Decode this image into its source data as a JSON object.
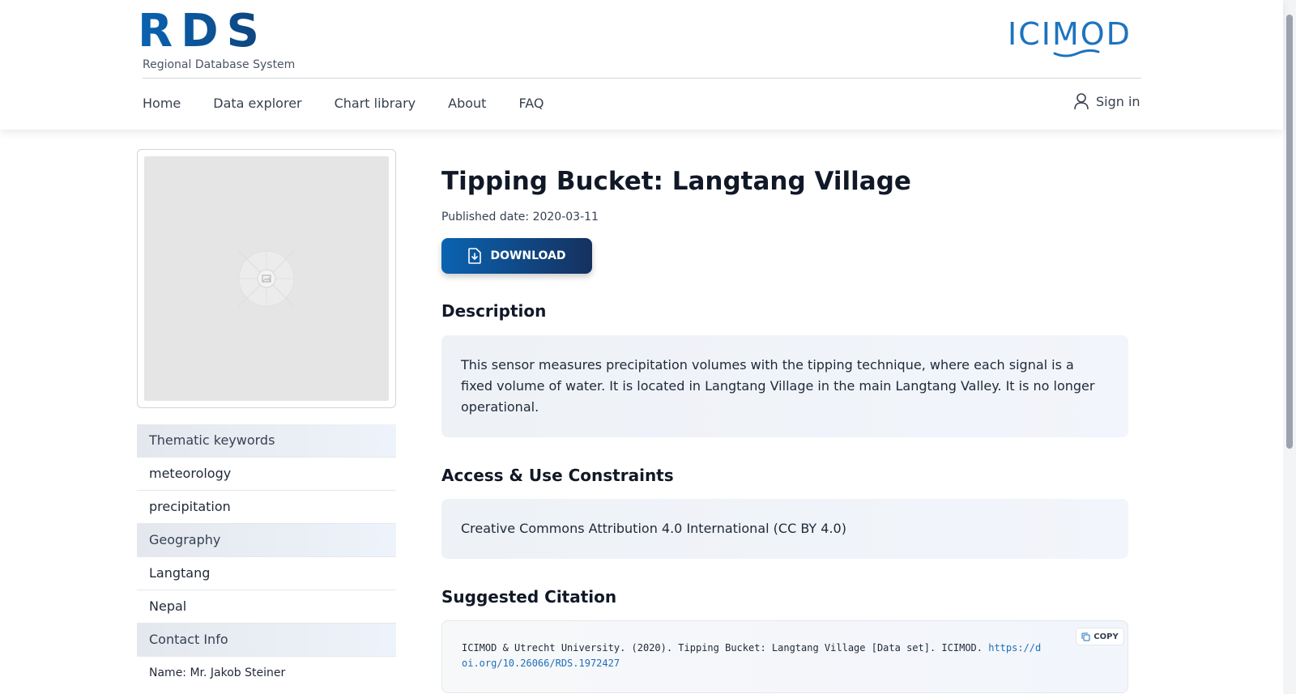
{
  "brand": {
    "logo": "RDS",
    "subtitle": "Regional Database System",
    "partner": "ICIMOD"
  },
  "nav": {
    "items": [
      "Home",
      "Data explorer",
      "Chart library",
      "About",
      "FAQ"
    ],
    "signin": "Sign in"
  },
  "dataset": {
    "title": "Tipping Bucket: Langtang Village",
    "published": "Published date: 2020-03-11",
    "download_label": "DOWNLOAD"
  },
  "sections": {
    "description_heading": "Description",
    "description": "This sensor measures precipitation volumes with the tipping technique, where each signal is a fixed volume of water. It is located in Langtang Village in the main Langtang Valley. It is no longer operational.",
    "access_heading": "Access & Use Constraints",
    "license": "Creative Commons Attribution 4.0 International (CC BY 4.0)",
    "citation_heading": "Suggested Citation",
    "citation": "ICIMOD & Utrecht University. (2020). Tipping Bucket: Langtang Village [Data set]. ICIMOD. ",
    "citation_link": "https://doi.org/10.26066/RDS.1972427",
    "copy_label": "COPY"
  },
  "sidebar": {
    "thematic_heading": "Thematic keywords",
    "thematic": [
      "meteorology",
      "precipitation"
    ],
    "geography_heading": "Geography",
    "geography": [
      "Langtang",
      "Nepal"
    ],
    "contact_heading": "Contact Info",
    "contact_name": "Name: Mr. Jakob Steiner"
  },
  "colors": {
    "brand_blue": "#0a63b1",
    "brand_navy": "#15315f",
    "link": "#1e6fba"
  }
}
